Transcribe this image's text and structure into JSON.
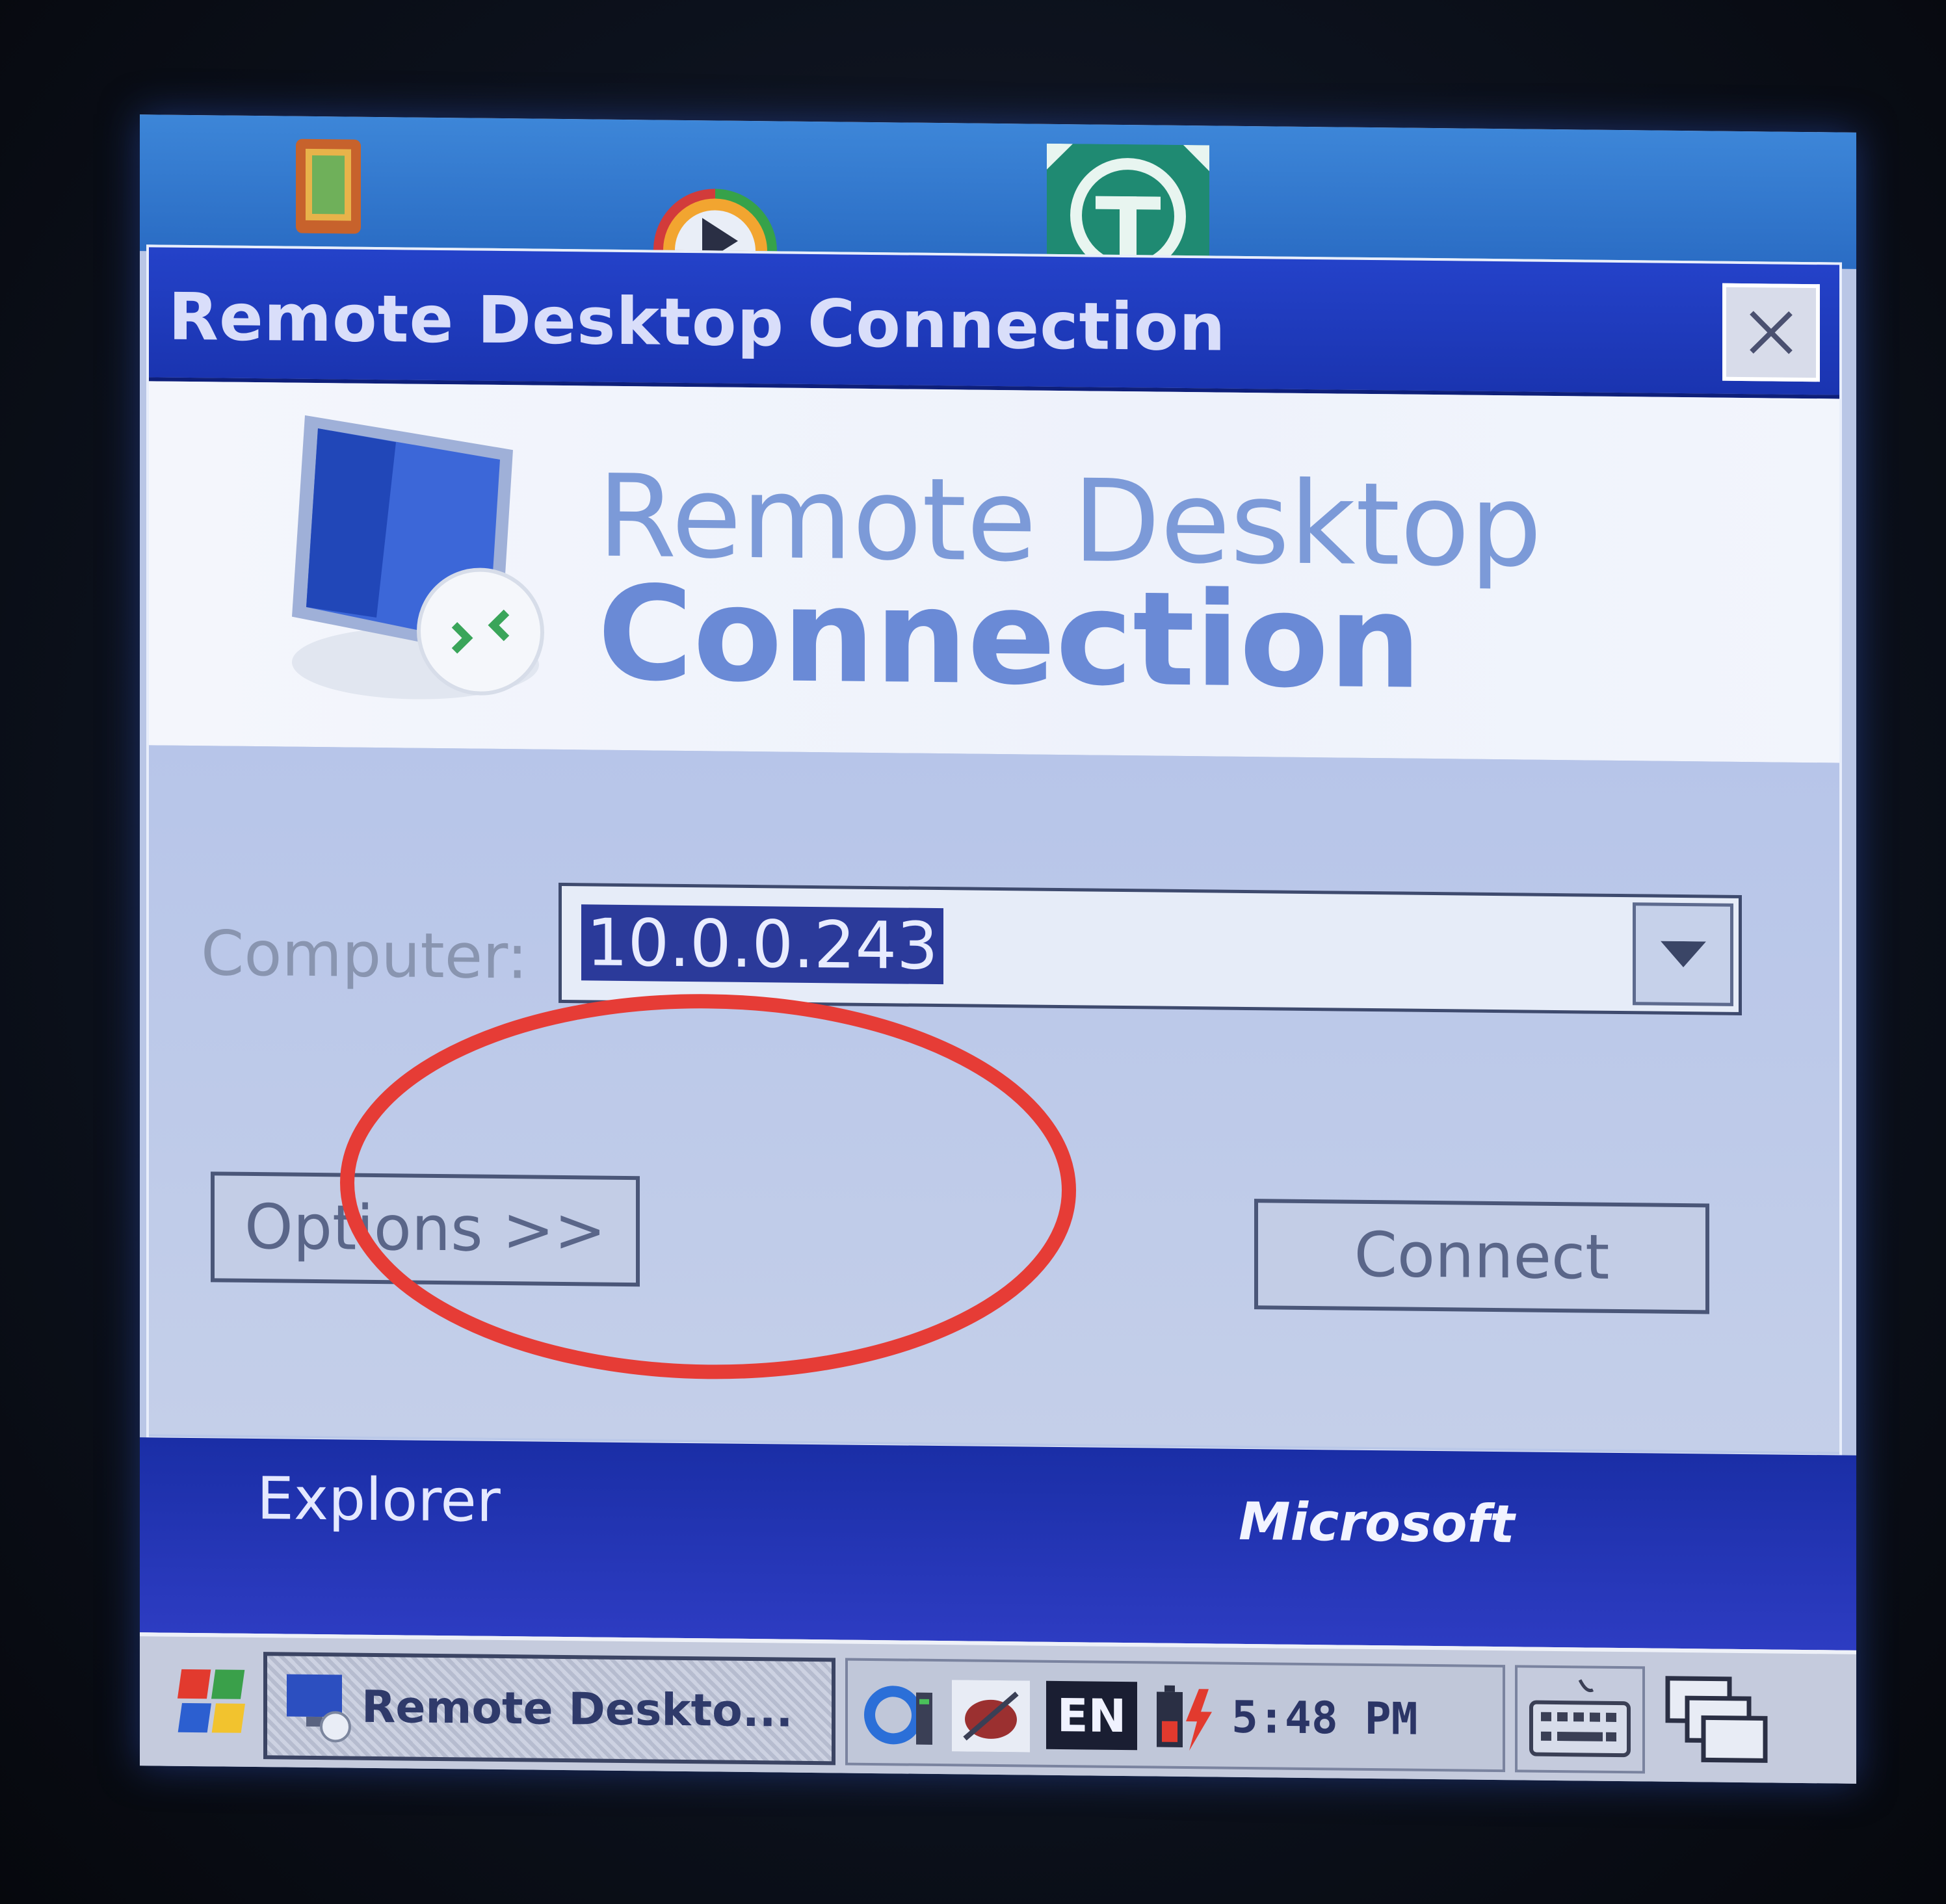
{
  "window": {
    "title": "Remote Desktop Connection",
    "close_label": "✕"
  },
  "banner": {
    "line1": "Remote Desktop",
    "line2": "Connection"
  },
  "form": {
    "computer_label": "Computer:",
    "computer_value": "10.0.0.243",
    "options_button": "Options >>",
    "connect_button": "Connect"
  },
  "explorer_bar": {
    "explorer_label": "Explorer",
    "brand_label": "Microsoft"
  },
  "taskbar": {
    "active_task": "Remote Deskto...",
    "language": "EN",
    "clock": "5:48 PM"
  },
  "colors": {
    "titlebar": "#1f3cc0",
    "annotation": "#e63c36",
    "selection": "#2b3a9a"
  },
  "icons": {
    "desktop": [
      "pda-icon",
      "media-player-icon",
      "teamviewer-icon"
    ],
    "tray": [
      "network-icon",
      "stylus-icon",
      "battery-charging-icon"
    ]
  }
}
